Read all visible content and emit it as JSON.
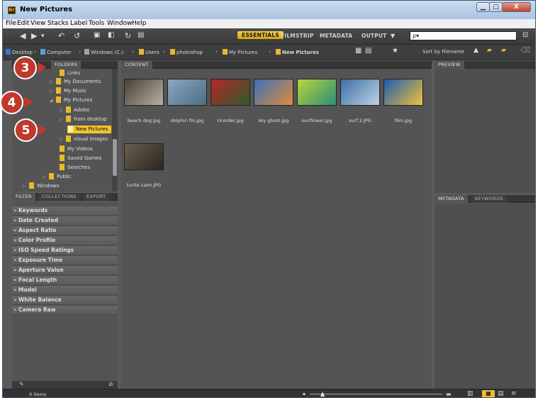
{
  "window": {
    "title": "New Pictures",
    "app_icon": "Br",
    "controls": {
      "minimize": "▁",
      "maximize": "□",
      "close": "X"
    }
  },
  "menu": [
    "File",
    "Edit",
    "View",
    "Stacks",
    "Label",
    "Tools",
    "Window",
    "Help"
  ],
  "toolbar": {
    "workspaces": [
      "ESSENTIALS",
      "FILMSTRIP",
      "METADATA",
      "OUTPUT"
    ],
    "active_workspace": "ESSENTIALS",
    "search_value": "ρ▾"
  },
  "breadcrumb": [
    "Desktop",
    "Computer",
    "Windows (C:)",
    "Users",
    "photoshop",
    "My Pictures",
    "New Pictures"
  ],
  "sort_label": "Sort by Filename",
  "panels": {
    "folders_tab": "FOLDERS",
    "content_tab": "CONTENT",
    "preview_tab": "PREVIEW",
    "filter_tabs": [
      "FILTER",
      "COLLECTIONS",
      "EXPORT"
    ],
    "metadata_tabs": [
      "METADATA",
      "KEYWORDS"
    ]
  },
  "folder_tree": [
    {
      "label": "Links"
    },
    {
      "label": "My Documents"
    },
    {
      "label": "My Music"
    },
    {
      "label": "My Pictures"
    },
    {
      "label": "Adobe"
    },
    {
      "label": "from desktop"
    },
    {
      "label": "New Pictures",
      "selected": true
    },
    {
      "label": "visual images"
    },
    {
      "label": "My Videos"
    },
    {
      "label": "Saved Games"
    },
    {
      "label": "Searches"
    },
    {
      "label": "Public"
    },
    {
      "label": "Windows"
    }
  ],
  "filters": [
    "Keywords",
    "Date Created",
    "Aspect Ratio",
    "Color Profile",
    "ISO Speed Ratings",
    "Exposure Time",
    "Aperture Value",
    "Focal Length",
    "Model",
    "White Balance",
    "Camera Raw"
  ],
  "thumbnails": [
    {
      "label": "beach dog.jpg",
      "colors": [
        "#4a3f35",
        "#b8b0a2"
      ]
    },
    {
      "label": "dolphin fin.jpg",
      "colors": [
        "#8aa7bd",
        "#4d6e85"
      ]
    },
    {
      "label": "ricorder.jpg",
      "colors": [
        "#b3262a",
        "#2e5c2a"
      ]
    },
    {
      "label": "sky ghost.jpg",
      "colors": [
        "#3a73b8",
        "#e08a3c"
      ]
    },
    {
      "label": "sunflower.jpg",
      "colors": [
        "#b9d43a",
        "#2d8f7a"
      ]
    },
    {
      "label": "surf 2.JPG",
      "colors": [
        "#3d6fa6",
        "#bcd2e4"
      ]
    },
    {
      "label": "film.jpg",
      "colors": [
        "#1c5bb0",
        "#f0c23a"
      ]
    },
    {
      "label": "turtle calm.JPG",
      "colors": [
        "#6b5f4e",
        "#2b2620"
      ]
    }
  ],
  "status": {
    "items": "0 items"
  },
  "callouts": [
    "3",
    "4",
    "5"
  ]
}
